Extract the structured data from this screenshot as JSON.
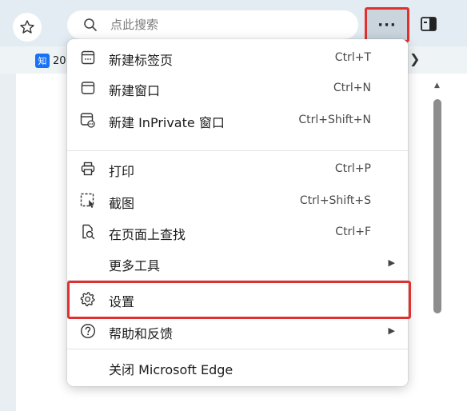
{
  "toolbar": {
    "search_placeholder": "点此搜索",
    "more_label": "···"
  },
  "favorites": {
    "item_text": "20",
    "logo_text": "知"
  },
  "menu": {
    "items": [
      {
        "label": "新建标签页",
        "shortcut": "Ctrl+T",
        "icon": "new-tab-icon"
      },
      {
        "label": "新建窗口",
        "shortcut": "Ctrl+N",
        "icon": "new-window-icon"
      },
      {
        "label": "新建 InPrivate 窗口",
        "shortcut": "Ctrl+Shift+N",
        "icon": "inprivate-window-icon"
      },
      {
        "label": "打印",
        "shortcut": "Ctrl+P",
        "icon": "print-icon"
      },
      {
        "label": "截图",
        "shortcut": "Ctrl+Shift+S",
        "icon": "screenshot-icon"
      },
      {
        "label": "在页面上查找",
        "shortcut": "Ctrl+F",
        "icon": "find-on-page-icon"
      },
      {
        "label": "更多工具",
        "shortcut": "",
        "icon": ""
      },
      {
        "label": "设置",
        "shortcut": "",
        "icon": "gear-icon"
      },
      {
        "label": "帮助和反馈",
        "shortcut": "",
        "icon": "help-icon"
      },
      {
        "label": "关闭 Microsoft Edge",
        "shortcut": "",
        "icon": ""
      }
    ]
  },
  "colors": {
    "highlight": "#e0312f",
    "toolbar_bg": "#e3ecf2"
  }
}
